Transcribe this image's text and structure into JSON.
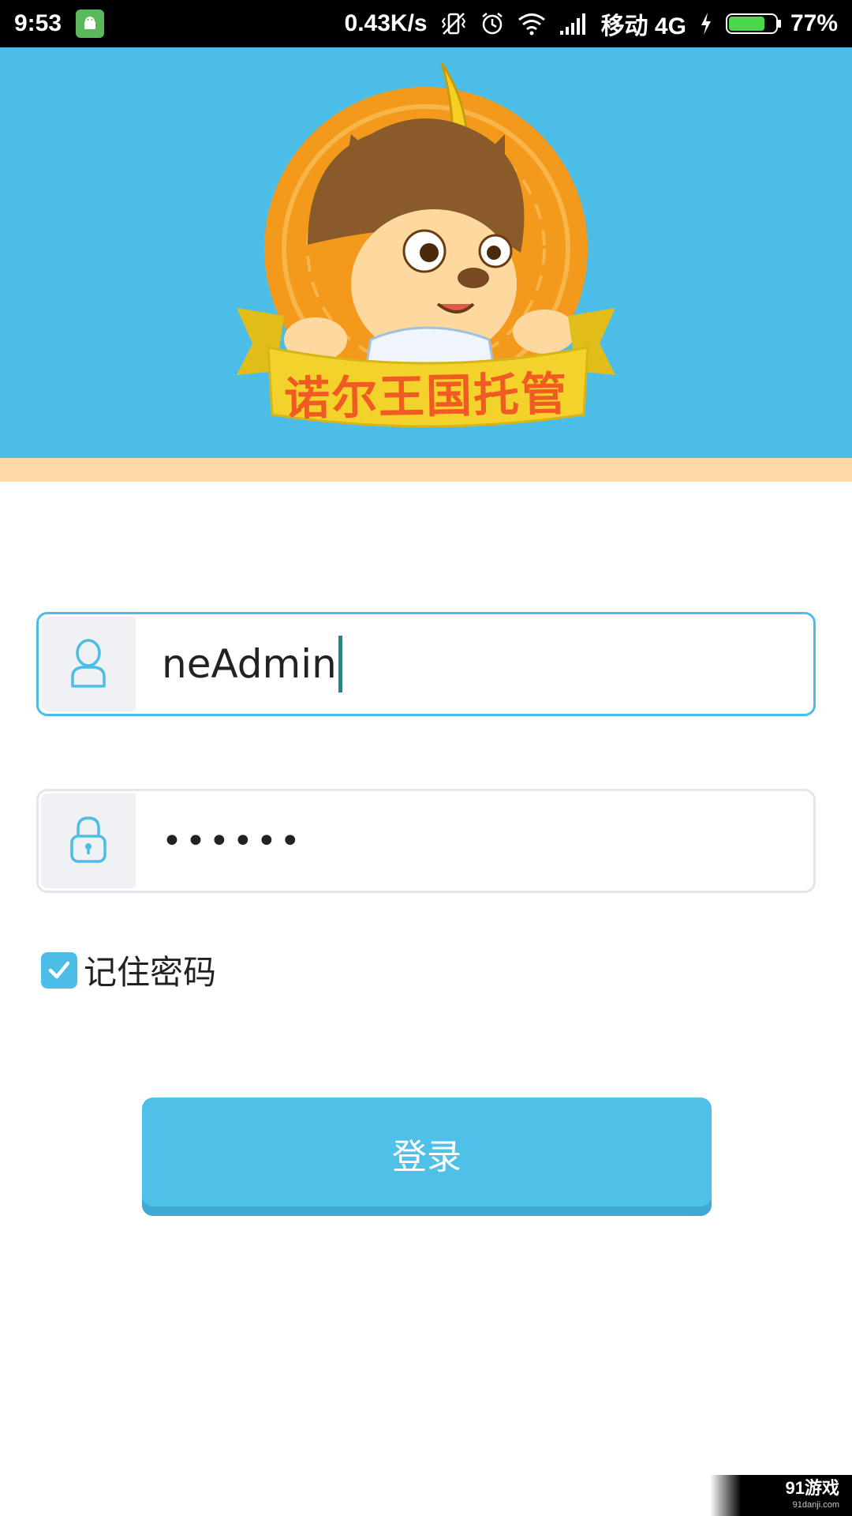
{
  "status_bar": {
    "time": "9:53",
    "net_speed": "0.43K/s",
    "carrier": "移动 4G",
    "battery_percent": "77%",
    "battery_level": 0.77,
    "icons": [
      "android-app-icon",
      "vibrate-off-icon",
      "alarm-icon",
      "wifi-icon",
      "signal-icon",
      "charging-icon",
      "battery-icon"
    ]
  },
  "banner": {
    "logo_text": "诺尔王国托管",
    "colors": {
      "background": "#4bbde6",
      "stripe": "#ffd9a6",
      "ribbon": "#f2d22b",
      "ribbon_text": "#f05a23",
      "medal": "#f39a1d"
    }
  },
  "login": {
    "username_value": "neAdmin",
    "password_value": "••••••",
    "remember_label": "记住密码",
    "remember_checked": true,
    "submit_label": "登录"
  },
  "watermark": {
    "main": "91游戏",
    "sub": "91danji.com"
  },
  "colors": {
    "accent": "#4fc1e9",
    "input_border_active": "#4bbde6",
    "input_border": "#e4e6ea",
    "icon_bg": "#eff1f5"
  }
}
